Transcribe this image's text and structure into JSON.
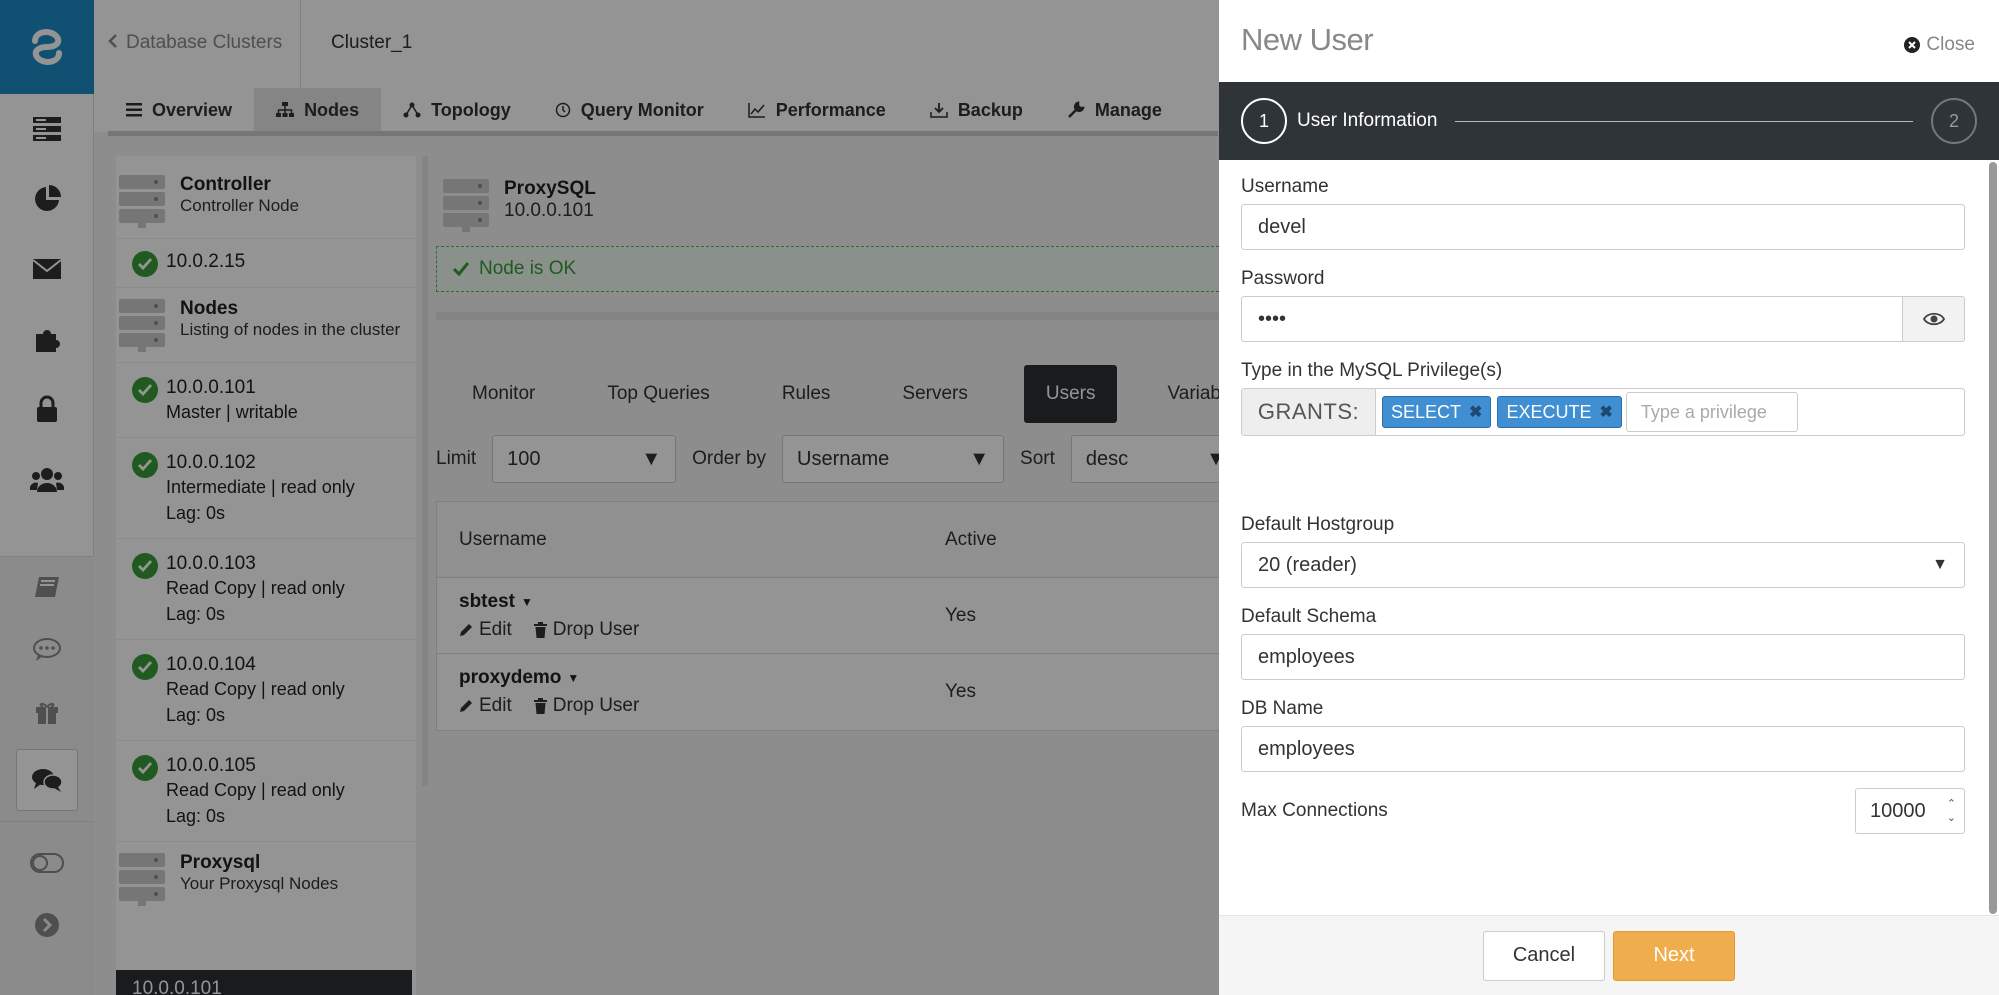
{
  "header": {
    "back_label": "Database Clusters",
    "cluster_name": "Cluster_1"
  },
  "nav_tabs": [
    {
      "label": "Overview",
      "icon": "menu-icon"
    },
    {
      "label": "Nodes",
      "icon": "sitemap-icon"
    },
    {
      "label": "Topology",
      "icon": "topology-icon"
    },
    {
      "label": "Query Monitor",
      "icon": "stopwatch-icon"
    },
    {
      "label": "Performance",
      "icon": "line-chart-icon"
    },
    {
      "label": "Backup",
      "icon": "download-icon"
    },
    {
      "label": "Manage",
      "icon": "wrench-icon"
    }
  ],
  "node_list": {
    "controller": {
      "title": "Controller",
      "subtitle": "Controller Node",
      "ip": "10.0.2.15"
    },
    "nodes_group": {
      "title": "Nodes",
      "subtitle": "Listing of nodes in the cluster"
    },
    "nodes": [
      {
        "ip": "10.0.0.101",
        "lines": [
          "Master | writable"
        ]
      },
      {
        "ip": "10.0.0.102",
        "lines": [
          "Intermediate | read only",
          "Lag: 0s"
        ]
      },
      {
        "ip": "10.0.0.103",
        "lines": [
          "Read Copy | read only",
          "Lag: 0s"
        ]
      },
      {
        "ip": "10.0.0.104",
        "lines": [
          "Read Copy | read only",
          "Lag: 0s"
        ]
      },
      {
        "ip": "10.0.0.105",
        "lines": [
          "Read Copy | read only",
          "Lag: 0s"
        ]
      }
    ],
    "proxysql_group": {
      "title": "Proxysql",
      "subtitle": "Your Proxysql Nodes"
    },
    "selected_ip": "10.0.0.101"
  },
  "detail": {
    "title": "ProxySQL",
    "ip": "10.0.0.101",
    "status": "Node is OK",
    "subtabs": [
      "Monitor",
      "Top Queries",
      "Rules",
      "Servers",
      "Users",
      "Variab"
    ],
    "active_subtab": "Users",
    "filters": {
      "limit_label": "Limit",
      "limit_value": "100",
      "order_label": "Order by",
      "order_value": "Username",
      "sort_label": "Sort",
      "sort_value": "desc"
    },
    "table": {
      "headers": [
        "Username",
        "Active"
      ],
      "rows": [
        {
          "username": "sbtest",
          "active": "Yes"
        },
        {
          "username": "proxydemo",
          "active": "Yes"
        }
      ],
      "edit_label": "Edit",
      "drop_label": "Drop User"
    }
  },
  "panel": {
    "title": "New User",
    "close_label": "Close",
    "step1_num": "1",
    "step1_label": "User Information",
    "step2_num": "2",
    "username_label": "Username",
    "username_value": "devel",
    "password_label": "Password",
    "password_value": "••••",
    "privileges_label": "Type in the MySQL Privilege(s)",
    "grants_label": "GRANTS:",
    "privileges": [
      "SELECT",
      "EXECUTE"
    ],
    "privilege_placeholder": "Type a privilege",
    "hostgroup_label": "Default Hostgroup",
    "hostgroup_value": "20 (reader)",
    "schema_label": "Default Schema",
    "schema_value": "employees",
    "dbname_label": "DB Name",
    "dbname_value": "employees",
    "maxconn_label": "Max Connections",
    "maxconn_value": "10000",
    "cancel_label": "Cancel",
    "next_label": "Next"
  },
  "colors": {
    "brand": "#1a8ac6",
    "ok_green": "#3a9c3a",
    "tag_blue": "#3f8fd2",
    "next_orange": "#f0ad4e",
    "dark": "#2f3438"
  }
}
